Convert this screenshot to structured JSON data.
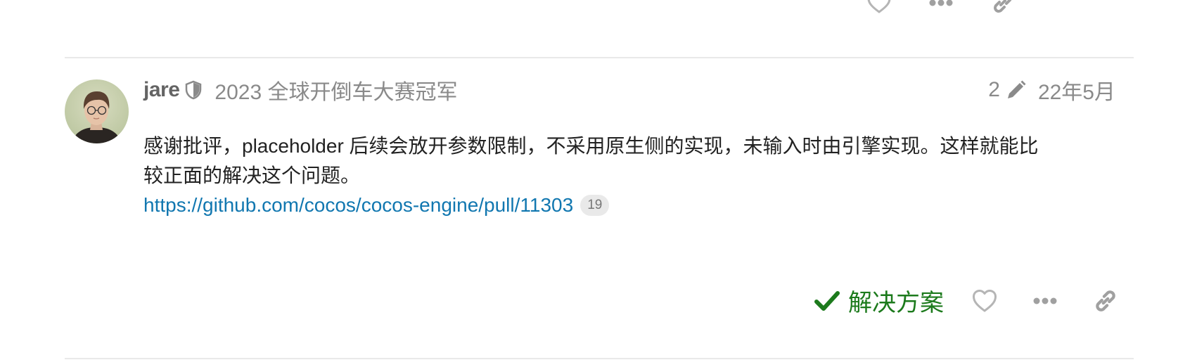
{
  "post": {
    "username": "jare",
    "user_title": "2023 全球开倒车大赛冠军",
    "edit_count": "2",
    "date": "22年5月",
    "body_line1": "感谢批评，placeholder 后续会放开参数限制，不采用原生侧的实现，未输入时由引擎实现。这样就能比",
    "body_line2": "较正面的解决这个问题。",
    "link_text": "https://github.com/cocos/cocos-engine/pull/11303",
    "link_clicks": "19",
    "solution_label": "解决方案"
  },
  "icons": {
    "moderator": "shield-icon",
    "edit": "pencil-icon",
    "solution": "check-icon",
    "like": "heart-icon",
    "more": "ellipsis-icon",
    "share": "link-icon"
  },
  "colors": {
    "link": "#1177b0",
    "solution": "#1c7a1c",
    "muted": "#8a8a8a"
  }
}
